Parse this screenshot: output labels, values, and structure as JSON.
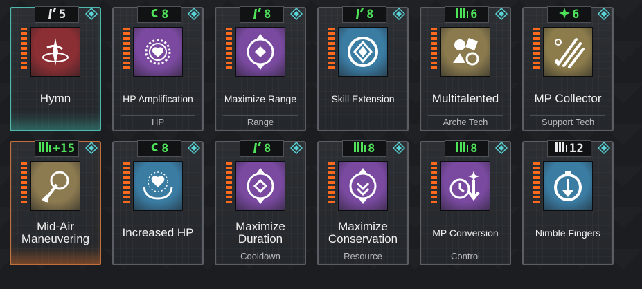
{
  "colors": {
    "teal_border": "#4fb8ad",
    "orange_border": "#c0703a",
    "cost_green": "#4fe35a",
    "led_orange": "#ff6a1c",
    "diamond_cyan": "#59d4d6"
  },
  "cards": [
    {
      "name": "Hymn",
      "cost_icon": "claw-icon",
      "cost_glyph": "/'",
      "cost": "5",
      "cost_color": "white",
      "category": "",
      "art": "hymn-icon",
      "art_color": "#8c2f34",
      "highlight": "teal",
      "size": "big"
    },
    {
      "name": "HP Amplification",
      "cost_icon": "c-icon",
      "cost_glyph": "C",
      "cost": "8",
      "cost_color": "green",
      "category": "HP",
      "art": "heart-spike-icon",
      "art_color": "#7b4aa0",
      "highlight": "",
      "size": "small"
    },
    {
      "name": "Maximize Range",
      "cost_icon": "claw-icon",
      "cost_glyph": "/'",
      "cost": "8",
      "cost_color": "green",
      "category": "Range",
      "art": "range-arrows-icon",
      "art_color": "#7a4aa1",
      "highlight": "",
      "size": "small"
    },
    {
      "name": "Skill Extension",
      "cost_icon": "claw-icon",
      "cost_glyph": "/'",
      "cost": "8",
      "cost_color": "green",
      "category": "",
      "art": "diamond-ring-icon",
      "art_color": "#3b7ca3",
      "highlight": "",
      "size": "small"
    },
    {
      "name": "Multitalented",
      "cost_icon": "m-icon",
      "cost_glyph": "M",
      "cost": "6",
      "cost_color": "green",
      "category": "Arche Tech",
      "art": "shapes-icon",
      "art_color": "#8a7a4e",
      "highlight": "",
      "size": "big"
    },
    {
      "name": "MP Collector",
      "cost_icon": "star-icon",
      "cost_glyph": "✕",
      "cost": "6",
      "cost_color": "green",
      "category": "Support Tech",
      "art": "claw-mark-icon",
      "art_color": "#8c7c4c",
      "highlight": "",
      "size": "big"
    },
    {
      "name": "Mid-Air Maneuvering",
      "cost_icon": "m-icon",
      "cost_glyph": "M",
      "cost": "+15",
      "cost_color": "green",
      "category": "",
      "art": "grapple-icon",
      "art_color": "#8c7a50",
      "highlight": "orange",
      "size": "big"
    },
    {
      "name": "Increased HP",
      "cost_icon": "c-icon",
      "cost_glyph": "C",
      "cost": "8",
      "cost_color": "green",
      "category": "",
      "art": "heart-hands-icon",
      "art_color": "#3b7ca3",
      "highlight": "",
      "size": "big"
    },
    {
      "name": "Maximize Duration",
      "cost_icon": "claw-icon",
      "cost_glyph": "/'",
      "cost": "8",
      "cost_color": "green",
      "category": "Cooldown",
      "art": "duration-arrows-icon",
      "art_color": "#7a4aa1",
      "highlight": "",
      "size": "big"
    },
    {
      "name": "Maximize Conservation",
      "cost_icon": "m-icon",
      "cost_glyph": "M",
      "cost": "8",
      "cost_color": "green",
      "category": "Resource",
      "art": "conservation-icon",
      "art_color": "#7a4aa1",
      "highlight": "",
      "size": "big"
    },
    {
      "name": "MP Conversion",
      "cost_icon": "m-icon",
      "cost_glyph": "M",
      "cost": "8",
      "cost_color": "green",
      "category": "Control",
      "art": "clock-down-icon",
      "art_color": "#7a4aa1",
      "highlight": "",
      "size": "small"
    },
    {
      "name": "Nimble Fingers",
      "cost_icon": "m-icon",
      "cost_glyph": "M",
      "cost": "12",
      "cost_color": "white",
      "category": "",
      "art": "stopwatch-icon",
      "art_color": "#3b7ca3",
      "highlight": "",
      "size": "small"
    }
  ]
}
